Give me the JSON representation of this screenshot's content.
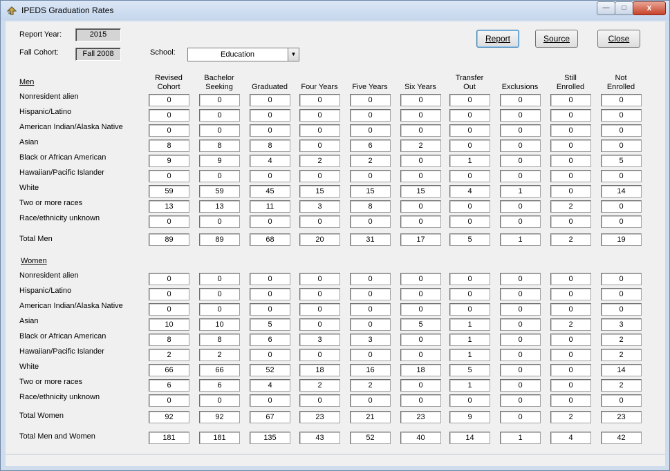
{
  "window": {
    "title": "IPEDS Graduation Rates",
    "controls": {
      "minimize": "—",
      "maximize": "□",
      "close": "x"
    }
  },
  "header": {
    "report_year_label": "Report Year:",
    "report_year_value": "2015",
    "fall_cohort_label": "Fall Cohort:",
    "fall_cohort_value": "Fall 2008",
    "school_label": "School:",
    "school_value": "Education"
  },
  "buttons": {
    "report": "Report",
    "source": "Source",
    "close": "Close"
  },
  "columns": [
    [
      "Revised",
      "Cohort"
    ],
    [
      "Bachelor",
      "Seeking"
    ],
    [
      "",
      "Graduated"
    ],
    [
      "",
      "Four Years"
    ],
    [
      "",
      "Five Years"
    ],
    [
      "",
      "Six Years"
    ],
    [
      "Transfer",
      "Out"
    ],
    [
      "",
      "Exclusions"
    ],
    [
      "Still",
      "Enrolled"
    ],
    [
      "Not",
      "Enrolled"
    ]
  ],
  "men": {
    "section_label": "Men",
    "rows": [
      {
        "label": "Nonresident alien",
        "values": [
          "0",
          "0",
          "0",
          "0",
          "0",
          "0",
          "0",
          "0",
          "0",
          "0"
        ]
      },
      {
        "label": "Hispanic/Latino",
        "values": [
          "0",
          "0",
          "0",
          "0",
          "0",
          "0",
          "0",
          "0",
          "0",
          "0"
        ]
      },
      {
        "label": "American Indian/Alaska Native",
        "values": [
          "0",
          "0",
          "0",
          "0",
          "0",
          "0",
          "0",
          "0",
          "0",
          "0"
        ]
      },
      {
        "label": "Asian",
        "values": [
          "8",
          "8",
          "8",
          "0",
          "6",
          "2",
          "0",
          "0",
          "0",
          "0"
        ]
      },
      {
        "label": "Black or African American",
        "values": [
          "9",
          "9",
          "4",
          "2",
          "2",
          "0",
          "1",
          "0",
          "0",
          "5"
        ]
      },
      {
        "label": "Hawaiian/Pacific Islander",
        "values": [
          "0",
          "0",
          "0",
          "0",
          "0",
          "0",
          "0",
          "0",
          "0",
          "0"
        ]
      },
      {
        "label": "White",
        "values": [
          "59",
          "59",
          "45",
          "15",
          "15",
          "15",
          "4",
          "1",
          "0",
          "14"
        ]
      },
      {
        "label": "Two or more races",
        "values": [
          "13",
          "13",
          "11",
          "3",
          "8",
          "0",
          "0",
          "0",
          "2",
          "0"
        ]
      },
      {
        "label": "Race/ethnicity unknown",
        "values": [
          "0",
          "0",
          "0",
          "0",
          "0",
          "0",
          "0",
          "0",
          "0",
          "0"
        ]
      }
    ],
    "total": {
      "label": "Total Men",
      "values": [
        "89",
        "89",
        "68",
        "20",
        "31",
        "17",
        "5",
        "1",
        "2",
        "19"
      ]
    }
  },
  "women": {
    "section_label": "Women",
    "rows": [
      {
        "label": "Nonresident alien",
        "values": [
          "0",
          "0",
          "0",
          "0",
          "0",
          "0",
          "0",
          "0",
          "0",
          "0"
        ]
      },
      {
        "label": "Hispanic/Latino",
        "values": [
          "0",
          "0",
          "0",
          "0",
          "0",
          "0",
          "0",
          "0",
          "0",
          "0"
        ]
      },
      {
        "label": "American Indian/Alaska Native",
        "values": [
          "0",
          "0",
          "0",
          "0",
          "0",
          "0",
          "0",
          "0",
          "0",
          "0"
        ]
      },
      {
        "label": "Asian",
        "values": [
          "10",
          "10",
          "5",
          "0",
          "0",
          "5",
          "1",
          "0",
          "2",
          "3"
        ]
      },
      {
        "label": "Black or African American",
        "values": [
          "8",
          "8",
          "6",
          "3",
          "3",
          "0",
          "1",
          "0",
          "0",
          "2"
        ]
      },
      {
        "label": "Hawaiian/Pacific Islander",
        "values": [
          "2",
          "2",
          "0",
          "0",
          "0",
          "0",
          "1",
          "0",
          "0",
          "2"
        ]
      },
      {
        "label": "White",
        "values": [
          "66",
          "66",
          "52",
          "18",
          "16",
          "18",
          "5",
          "0",
          "0",
          "14"
        ]
      },
      {
        "label": "Two or more races",
        "values": [
          "6",
          "6",
          "4",
          "2",
          "2",
          "0",
          "1",
          "0",
          "0",
          "2"
        ]
      },
      {
        "label": "Race/ethnicity unknown",
        "values": [
          "0",
          "0",
          "0",
          "0",
          "0",
          "0",
          "0",
          "0",
          "0",
          "0"
        ]
      }
    ],
    "total": {
      "label": "Total Women",
      "values": [
        "92",
        "92",
        "67",
        "23",
        "21",
        "23",
        "9",
        "0",
        "2",
        "23"
      ]
    }
  },
  "grand_total": {
    "label": "Total Men and Women",
    "values": [
      "181",
      "181",
      "135",
      "43",
      "52",
      "40",
      "14",
      "1",
      "4",
      "42"
    ]
  }
}
